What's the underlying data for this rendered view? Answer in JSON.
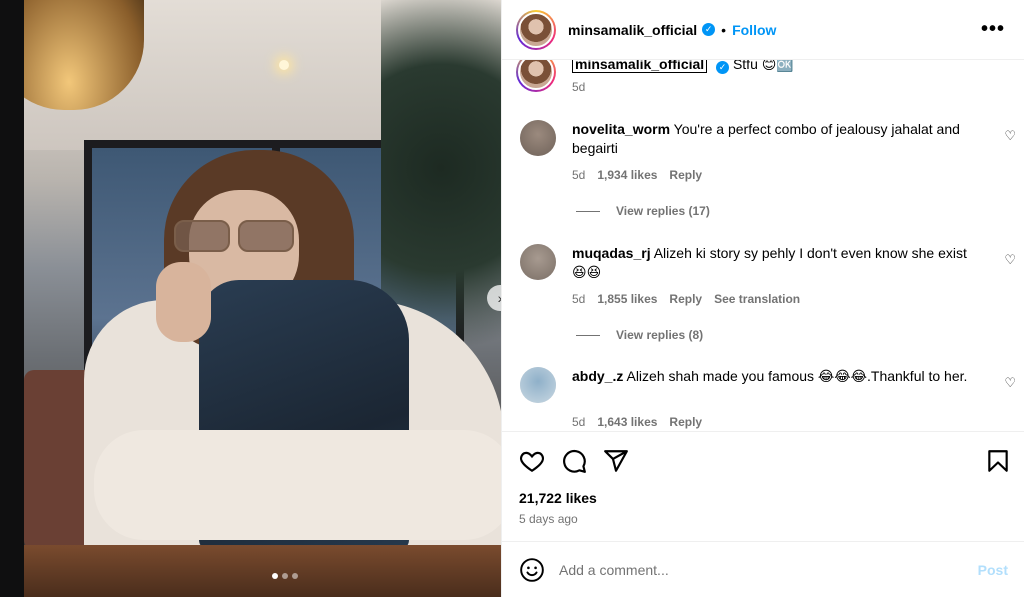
{
  "post": {
    "username": "minsamalik_official",
    "follow_label": "Follow",
    "separator": "•",
    "more_label": "•••",
    "caption_username": "minsamalik_official",
    "caption_text": "Stfu 😊🆗",
    "caption_time": "5d"
  },
  "comments": [
    {
      "username": "novelita_worm",
      "text": "You're a perfect combo of jealousy jahalat and begairti",
      "time": "5d",
      "likes": "1,934 likes",
      "reply": "Reply",
      "view_replies": "View replies (17)"
    },
    {
      "username": "muqadas_rj",
      "text": "Alizeh ki story sy pehly I don't even know she exist 😆😆",
      "time": "5d",
      "likes": "1,855 likes",
      "reply": "Reply",
      "translate": "See translation",
      "view_replies": "View replies (8)"
    },
    {
      "username": "abdy_.z",
      "text": "Alizeh shah made you famous 😂😂😂.Thankful to her.",
      "time": "5d",
      "likes": "1,643 likes",
      "reply": "Reply"
    }
  ],
  "stats": {
    "likes": "21,722 likes",
    "date": "5 days ago"
  },
  "composer": {
    "placeholder": "Add a comment...",
    "post_label": "Post",
    "emoji_icon": "smiley-icon"
  },
  "carousel": {
    "current": 1,
    "total": 3
  },
  "colors": {
    "accent": "#0095f6",
    "muted": "#737373",
    "post_disabled": "#b2dffc"
  }
}
